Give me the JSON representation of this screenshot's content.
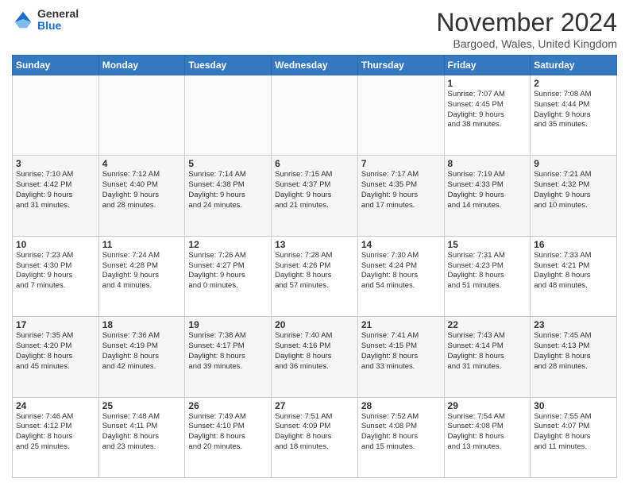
{
  "logo": {
    "general": "General",
    "blue": "Blue"
  },
  "header": {
    "month_title": "November 2024",
    "location": "Bargoed, Wales, United Kingdom"
  },
  "days_of_week": [
    "Sunday",
    "Monday",
    "Tuesday",
    "Wednesday",
    "Thursday",
    "Friday",
    "Saturday"
  ],
  "weeks": [
    [
      {
        "day": "",
        "info": ""
      },
      {
        "day": "",
        "info": ""
      },
      {
        "day": "",
        "info": ""
      },
      {
        "day": "",
        "info": ""
      },
      {
        "day": "",
        "info": ""
      },
      {
        "day": "1",
        "info": "Sunrise: 7:07 AM\nSunset: 4:45 PM\nDaylight: 9 hours\nand 38 minutes."
      },
      {
        "day": "2",
        "info": "Sunrise: 7:08 AM\nSunset: 4:44 PM\nDaylight: 9 hours\nand 35 minutes."
      }
    ],
    [
      {
        "day": "3",
        "info": "Sunrise: 7:10 AM\nSunset: 4:42 PM\nDaylight: 9 hours\nand 31 minutes."
      },
      {
        "day": "4",
        "info": "Sunrise: 7:12 AM\nSunset: 4:40 PM\nDaylight: 9 hours\nand 28 minutes."
      },
      {
        "day": "5",
        "info": "Sunrise: 7:14 AM\nSunset: 4:38 PM\nDaylight: 9 hours\nand 24 minutes."
      },
      {
        "day": "6",
        "info": "Sunrise: 7:15 AM\nSunset: 4:37 PM\nDaylight: 9 hours\nand 21 minutes."
      },
      {
        "day": "7",
        "info": "Sunrise: 7:17 AM\nSunset: 4:35 PM\nDaylight: 9 hours\nand 17 minutes."
      },
      {
        "day": "8",
        "info": "Sunrise: 7:19 AM\nSunset: 4:33 PM\nDaylight: 9 hours\nand 14 minutes."
      },
      {
        "day": "9",
        "info": "Sunrise: 7:21 AM\nSunset: 4:32 PM\nDaylight: 9 hours\nand 10 minutes."
      }
    ],
    [
      {
        "day": "10",
        "info": "Sunrise: 7:23 AM\nSunset: 4:30 PM\nDaylight: 9 hours\nand 7 minutes."
      },
      {
        "day": "11",
        "info": "Sunrise: 7:24 AM\nSunset: 4:28 PM\nDaylight: 9 hours\nand 4 minutes."
      },
      {
        "day": "12",
        "info": "Sunrise: 7:26 AM\nSunset: 4:27 PM\nDaylight: 9 hours\nand 0 minutes."
      },
      {
        "day": "13",
        "info": "Sunrise: 7:28 AM\nSunset: 4:26 PM\nDaylight: 8 hours\nand 57 minutes."
      },
      {
        "day": "14",
        "info": "Sunrise: 7:30 AM\nSunset: 4:24 PM\nDaylight: 8 hours\nand 54 minutes."
      },
      {
        "day": "15",
        "info": "Sunrise: 7:31 AM\nSunset: 4:23 PM\nDaylight: 8 hours\nand 51 minutes."
      },
      {
        "day": "16",
        "info": "Sunrise: 7:33 AM\nSunset: 4:21 PM\nDaylight: 8 hours\nand 48 minutes."
      }
    ],
    [
      {
        "day": "17",
        "info": "Sunrise: 7:35 AM\nSunset: 4:20 PM\nDaylight: 8 hours\nand 45 minutes."
      },
      {
        "day": "18",
        "info": "Sunrise: 7:36 AM\nSunset: 4:19 PM\nDaylight: 8 hours\nand 42 minutes."
      },
      {
        "day": "19",
        "info": "Sunrise: 7:38 AM\nSunset: 4:17 PM\nDaylight: 8 hours\nand 39 minutes."
      },
      {
        "day": "20",
        "info": "Sunrise: 7:40 AM\nSunset: 4:16 PM\nDaylight: 8 hours\nand 36 minutes."
      },
      {
        "day": "21",
        "info": "Sunrise: 7:41 AM\nSunset: 4:15 PM\nDaylight: 8 hours\nand 33 minutes."
      },
      {
        "day": "22",
        "info": "Sunrise: 7:43 AM\nSunset: 4:14 PM\nDaylight: 8 hours\nand 31 minutes."
      },
      {
        "day": "23",
        "info": "Sunrise: 7:45 AM\nSunset: 4:13 PM\nDaylight: 8 hours\nand 28 minutes."
      }
    ],
    [
      {
        "day": "24",
        "info": "Sunrise: 7:46 AM\nSunset: 4:12 PM\nDaylight: 8 hours\nand 25 minutes."
      },
      {
        "day": "25",
        "info": "Sunrise: 7:48 AM\nSunset: 4:11 PM\nDaylight: 8 hours\nand 23 minutes."
      },
      {
        "day": "26",
        "info": "Sunrise: 7:49 AM\nSunset: 4:10 PM\nDaylight: 8 hours\nand 20 minutes."
      },
      {
        "day": "27",
        "info": "Sunrise: 7:51 AM\nSunset: 4:09 PM\nDaylight: 8 hours\nand 18 minutes."
      },
      {
        "day": "28",
        "info": "Sunrise: 7:52 AM\nSunset: 4:08 PM\nDaylight: 8 hours\nand 15 minutes."
      },
      {
        "day": "29",
        "info": "Sunrise: 7:54 AM\nSunset: 4:08 PM\nDaylight: 8 hours\nand 13 minutes."
      },
      {
        "day": "30",
        "info": "Sunrise: 7:55 AM\nSunset: 4:07 PM\nDaylight: 8 hours\nand 11 minutes."
      }
    ]
  ]
}
